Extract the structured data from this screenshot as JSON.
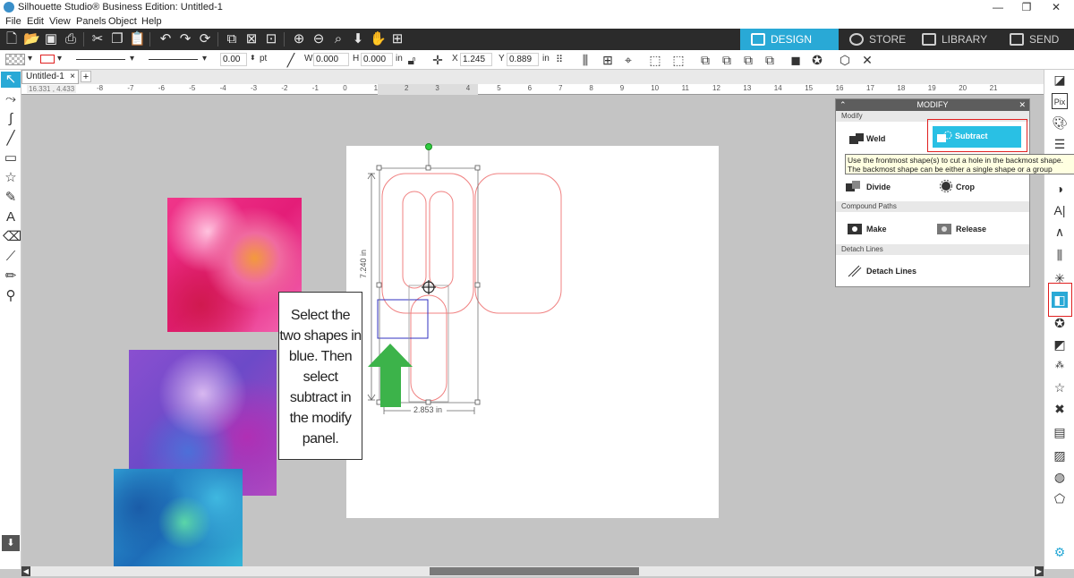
{
  "window": {
    "title": "Silhouette Studio® Business Edition: Untitled-1",
    "minimize": "—",
    "maximize": "❐",
    "close": "✕"
  },
  "menu": [
    "File",
    "Edit",
    "View",
    "Panels",
    "Object",
    "Help"
  ],
  "mode_tabs": [
    {
      "label": "DESIGN",
      "active": true
    },
    {
      "label": "STORE",
      "active": false
    },
    {
      "label": "LIBRARY",
      "active": false
    },
    {
      "label": "SEND",
      "active": false
    }
  ],
  "props": {
    "stroke_width": "0.00",
    "stroke_unit": "pt",
    "w_label": "W",
    "w_value": "0.000",
    "h_label": "H",
    "h_value": "0.000",
    "size_unit": "in",
    "x_label": "X",
    "x_value": "1.245",
    "y_label": "Y",
    "y_value": "0.889",
    "pos_unit": "in"
  },
  "doc_tab": {
    "label": "Untitled-1",
    "close": "×",
    "add": "+"
  },
  "ruler": {
    "cursor_readout": "16.331 , 4.433",
    "ticks": [
      "-8",
      "-7",
      "-6",
      "-5",
      "-4",
      "-3",
      "-2",
      "-1",
      "0",
      "1",
      "2",
      "3",
      "4",
      "5",
      "6",
      "7",
      "8",
      "9",
      "10",
      "11",
      "12",
      "13",
      "14",
      "15",
      "16",
      "17",
      "18",
      "19",
      "20",
      "21"
    ]
  },
  "canvas": {
    "height_dim": "7.240 in",
    "width_dim": "2.853 in"
  },
  "callout": {
    "text": "Select the two shapes in blue. Then select subtract in the modify panel."
  },
  "modify_panel": {
    "title": "MODIFY",
    "section_modify": "Modify",
    "weld": "Weld",
    "subtract": "Subtract",
    "divide": "Divide",
    "crop": "Crop",
    "section_compound": "Compound Paths",
    "make": "Make",
    "release": "Release",
    "section_detach": "Detach Lines",
    "detach_lines": "Detach Lines",
    "tooltip_line1": "Use the frontmost shape(s) to cut a hole in the backmost shape.",
    "tooltip_line2": "The backmost shape can be either a single shape or a group"
  },
  "colors": {
    "accent": "#29a9d6",
    "toolbar_bg": "#2b2b2b",
    "shape_outline": "#f08080",
    "selected_shape": "#3030c0",
    "arrow": "#3cb34a",
    "highlight_box": "#e02020"
  },
  "icons": {
    "toolbar": [
      "new-doc-icon",
      "open-icon",
      "save-icon",
      "print-icon",
      "cut-icon",
      "copy-icon",
      "paste-icon",
      "undo-icon",
      "redo-icon",
      "refresh-icon",
      "group-icon",
      "ungroup-icon",
      "select-all-icon",
      "zoom-in-icon",
      "zoom-out-icon",
      "zoom-fit-icon",
      "move-down-icon",
      "pan-hand-icon",
      "page-fit-icon"
    ],
    "left": [
      "pointer-icon",
      "edit-points-icon",
      "curve-icon",
      "line-icon",
      "rectangle-icon",
      "ellipse-icon",
      "star-icon",
      "pen-icon",
      "text-icon",
      "eraser-icon",
      "knife-icon",
      "pencil-icon",
      "eyedropper-icon"
    ],
    "right": [
      "page-setup-icon",
      "pixscan-icon",
      "palette-icon",
      "lines-icon",
      "fill-icon",
      "font-icon",
      "sketch-icon",
      "align-icon",
      "replicate-icon",
      "modify-icon",
      "offset-icon",
      "trace-icon",
      "rhinestone-icon",
      "star-panel-icon",
      "transform-icon",
      "layers-icon",
      "emboss-icon",
      "print-cut-icon",
      "library-icon"
    ]
  }
}
